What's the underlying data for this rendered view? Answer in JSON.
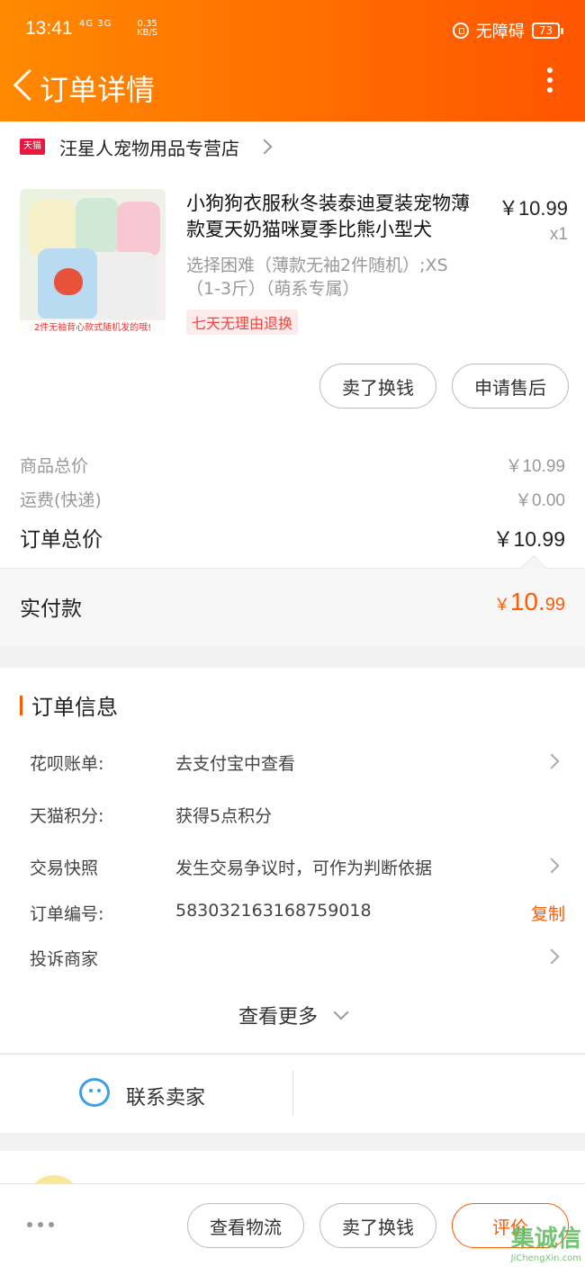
{
  "status_bar": {
    "time": "13:41",
    "network": "4G 3G",
    "speed_value": "0.35",
    "speed_unit": "KB/S",
    "accessibility": "无障碍",
    "battery": "73"
  },
  "nav": {
    "title": "订单详情"
  },
  "shop": {
    "badge": "天猫",
    "name": "汪星人宠物用品专营店"
  },
  "product": {
    "image_caption": "2件无袖背心款式随机发的哦!",
    "title": "小狗狗衣服秋冬装泰迪夏装宠物薄款夏天奶猫咪夏季比熊小型犬",
    "price": "￥10.99",
    "qty": "x1",
    "sku": "选择困难（薄款无袖2件随机）;XS（1-3斤）（萌系专属）",
    "tag": "七天无理由退换",
    "buttons": [
      "卖了换钱",
      "申请售后"
    ]
  },
  "summary": {
    "goods_label": "商品总价",
    "goods_value": "￥10.99",
    "shipping_label": "运费(快递)",
    "shipping_value": "￥0.00",
    "total_label": "订单总价",
    "total_value": "￥10.99",
    "paid_label": "实付款",
    "paid_symbol": "￥",
    "paid_int": "10.",
    "paid_dec": "99"
  },
  "order_info": {
    "title": "订单信息",
    "rows": [
      {
        "label": "花呗账单:",
        "value": "去支付宝中查看"
      },
      {
        "label": "天猫积分:",
        "value": "获得5点积分"
      },
      {
        "label": "交易快照",
        "value": "发生交易争议时，可作为判断依据"
      },
      {
        "label": "订单编号:",
        "value": "583032163168759018",
        "action": "复制"
      },
      {
        "label": "投诉商家",
        "value": ""
      }
    ],
    "see_more": "查看更多"
  },
  "contact": {
    "label": "联系卖家"
  },
  "action_bar": {
    "logistics": "查看物流",
    "sell": "卖了换钱",
    "rate": "评价"
  },
  "watermark": {
    "text": "集诚信",
    "url": "JiChengXin.com"
  },
  "colors": {
    "accent": "#ff5a00",
    "header_start": "#ff8a00",
    "header_end": "#ff5500",
    "tmall_red": "#e8173c"
  }
}
